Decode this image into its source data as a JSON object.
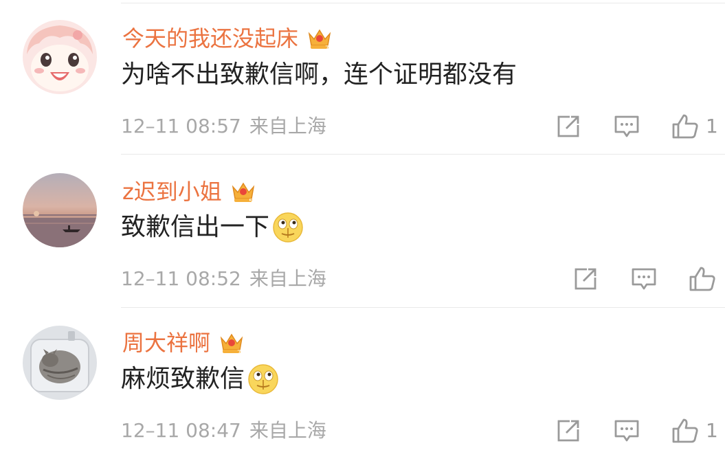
{
  "comments": [
    {
      "username": "今天的我还没起床",
      "badge_level": "7",
      "text": "为啥不出致歉信啊，连个证明都没有",
      "time": "12–11 08:57",
      "location": "来自上海",
      "like_count": "1",
      "avatar": "anime-girl-avatar"
    },
    {
      "username": "z迟到小姐",
      "badge_level": "5",
      "text": "致歉信出一下",
      "time": "12–11 08:52",
      "location": "来自上海",
      "like_count": "",
      "avatar": "sunset-lake-avatar",
      "emoji": "smirk-face"
    },
    {
      "username": "周大祥啊",
      "badge_level": "7",
      "text": "麻烦致歉信",
      "time": "12–11 08:47",
      "location": "来自上海",
      "like_count": "1",
      "avatar": "cat-in-sink-avatar",
      "emoji": "smirk-face"
    }
  ],
  "colors": {
    "username": "#eb7340",
    "text": "#222222",
    "meta": "#a8a8a8",
    "icon": "#9a9a9a"
  }
}
